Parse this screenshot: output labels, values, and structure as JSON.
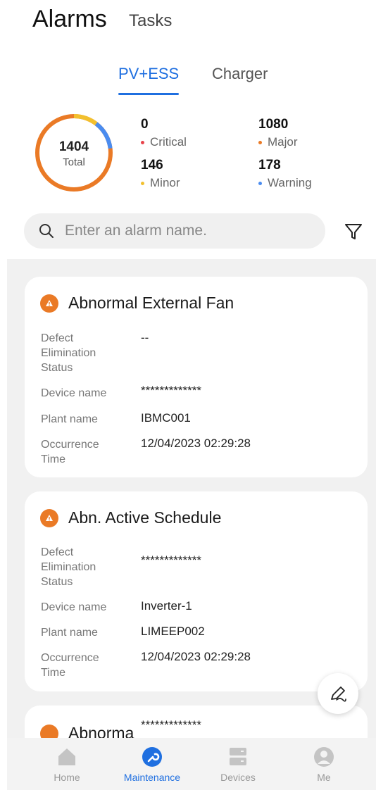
{
  "header": {
    "title": "Alarms",
    "secondary_tab": "Tasks"
  },
  "subtabs": [
    {
      "label": "PV+ESS",
      "active": true
    },
    {
      "label": "Charger",
      "active": false
    }
  ],
  "summary": {
    "total": "1404",
    "total_label": "Total",
    "stats": [
      {
        "value": "0",
        "label": "Critical",
        "color": "#e8434a"
      },
      {
        "value": "1080",
        "label": "Major",
        "color": "#ea7a26"
      },
      {
        "value": "146",
        "label": "Minor",
        "color": "#f2c02e"
      },
      {
        "value": "178",
        "label": "Warning",
        "color": "#4a8cf0"
      }
    ]
  },
  "search": {
    "placeholder": "Enter an alarm name."
  },
  "alarms": [
    {
      "title": "Abnormal External Fan",
      "defect_label": "Defect Elimination Status",
      "defect_value": "--",
      "device_label": "Device name",
      "device_value": "*************",
      "plant_label": "Plant name",
      "plant_value": "IBMC001",
      "time_label": "Occurrence Time",
      "time_value": "12/04/2023 02:29:28"
    },
    {
      "title": "Abn. Active Schedule",
      "defect_label": "Defect Elimination Status",
      "defect_value": "*************",
      "device_label": "Device name",
      "device_value": "Inverter-1",
      "plant_label": "Plant name",
      "plant_value": "LIMEEP002",
      "time_label": "Occurrence Time",
      "time_value": "12/04/2023 02:29:28"
    },
    {
      "title": "Abnorma",
      "overlay_value": "*************"
    }
  ],
  "nav": [
    {
      "label": "Home",
      "active": false
    },
    {
      "label": "Maintenance",
      "active": true
    },
    {
      "label": "Devices",
      "active": false
    },
    {
      "label": "Me",
      "active": false
    }
  ],
  "colors": {
    "accent": "#1f6fe0",
    "major": "#ea7a26"
  }
}
